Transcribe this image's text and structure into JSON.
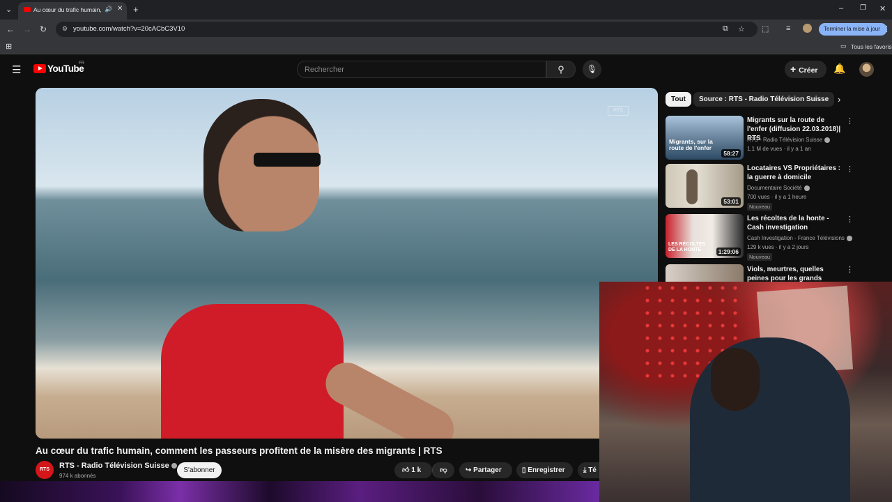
{
  "browser": {
    "tab_title": "Au cœur du trafic humain, c",
    "url": "youtube.com/watch?v=20cACbC3V10",
    "update_button": "Terminer la mise à jour",
    "bookmarks_all": "Tous les favoris"
  },
  "youtube": {
    "logo_text": "YouTube",
    "region": "FR",
    "search_placeholder": "Rechercher",
    "create_label": "Créer"
  },
  "video": {
    "title": "Au cœur du trafic humain, comment les passeurs profitent de la misère des migrants | RTS",
    "channel_logo": "RTS",
    "channel_name": "RTS - Radio Télévision Suisse",
    "subscribers": "974 k abonnés",
    "subscribe_label": "S'abonner",
    "likes": "1 k",
    "share_label": "Partager",
    "save_label": "Enregistrer",
    "download_label": "Té",
    "watermark": "RTS"
  },
  "sidebar": {
    "chips": [
      "Tout",
      "Source : RTS - Radio Télévision Suisse"
    ],
    "items": [
      {
        "title": "Migrants sur la route de l'enfer (diffusion 22.03.2018)| RTS",
        "channel": "RTS - Radio Télévision Suisse",
        "meta": "1,1 M de vues · il y a 1 an",
        "duration": "58:27",
        "thumb_text": "Migrants, sur la route de l'enfer",
        "badge": ""
      },
      {
        "title": "Locataires VS Propriétaires : la guerre à domicile",
        "channel": "Documentaire Société",
        "meta": "700 vues · il y a 1 heure",
        "duration": "53:01",
        "thumb_text": "",
        "badge": "Nouveau"
      },
      {
        "title": "Les récoltes de la honte - Cash investigation",
        "channel": "Cash Investigation - France Télévisions",
        "meta": "129 k vues · il y a 2 jours",
        "duration": "1:29:06",
        "thumb_text": "LES RÉCOLTES DE LA HONTE",
        "badge": "Nouveau"
      },
      {
        "title": "Viols, meurtres, quelles peines pour les grands assassins? | ...",
        "channel": "",
        "meta": "",
        "duration": "",
        "thumb_text": "",
        "badge": ""
      }
    ]
  },
  "colors": {
    "yt_red": "#ff0000",
    "rts_red": "#d4151a",
    "chrome_blue": "#8ab4f8",
    "background": "#0f0f0f"
  }
}
